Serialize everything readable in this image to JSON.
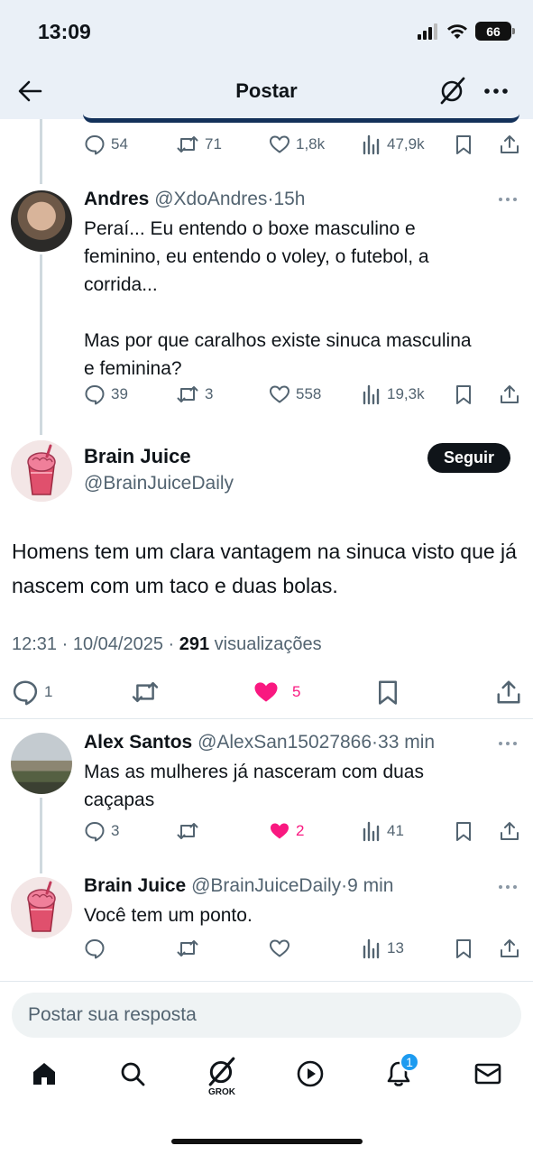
{
  "status_bar": {
    "time": "13:09",
    "battery": "66"
  },
  "header": {
    "title": "Postar"
  },
  "prev_tweet_stats": {
    "replies": "54",
    "reposts": "71",
    "likes": "1,8k",
    "views": "47,9k"
  },
  "tweets": [
    {
      "name": "Andres",
      "handle": "@XdoAndres",
      "time": "15h",
      "text": "Peraí... Eu entendo o boxe masculino e\nfeminino, eu entendo o voley, o futebol, a\ncorrida...\n\nMas por que caralhos existe sinuca masculina\ne feminina?",
      "replies": "39",
      "reposts": "3",
      "likes": "558",
      "views": "19,3k"
    }
  ],
  "main_post": {
    "name": "Brain Juice",
    "handle": "@BrainJuiceDaily",
    "follow_label": "Seguir",
    "text": "Homens tem um clara vantagem na sinuca visto que já nascem com um taco e duas bolas.",
    "time": "12:31",
    "date": "10/04/2025",
    "views_count": "291",
    "views_label": "visualizações",
    "replies": "1",
    "likes": "5",
    "like_color": "#f91880"
  },
  "replies": [
    {
      "name": "Alex Santos",
      "handle": "@AlexSan15027866",
      "time": "33 min",
      "text": "Mas as mulheres já nasceram com duas\ncaçapas",
      "replies": "3",
      "likes": "2",
      "views": "41"
    },
    {
      "name": "Brain Juice",
      "handle": "@BrainJuiceDaily",
      "time": "9 min",
      "text": "Você tem um ponto.",
      "views": "13"
    }
  ],
  "reply_box": {
    "placeholder": "Postar sua resposta"
  },
  "tab_bar": {
    "grok_label": "GROK",
    "notifications_badge": "1"
  }
}
